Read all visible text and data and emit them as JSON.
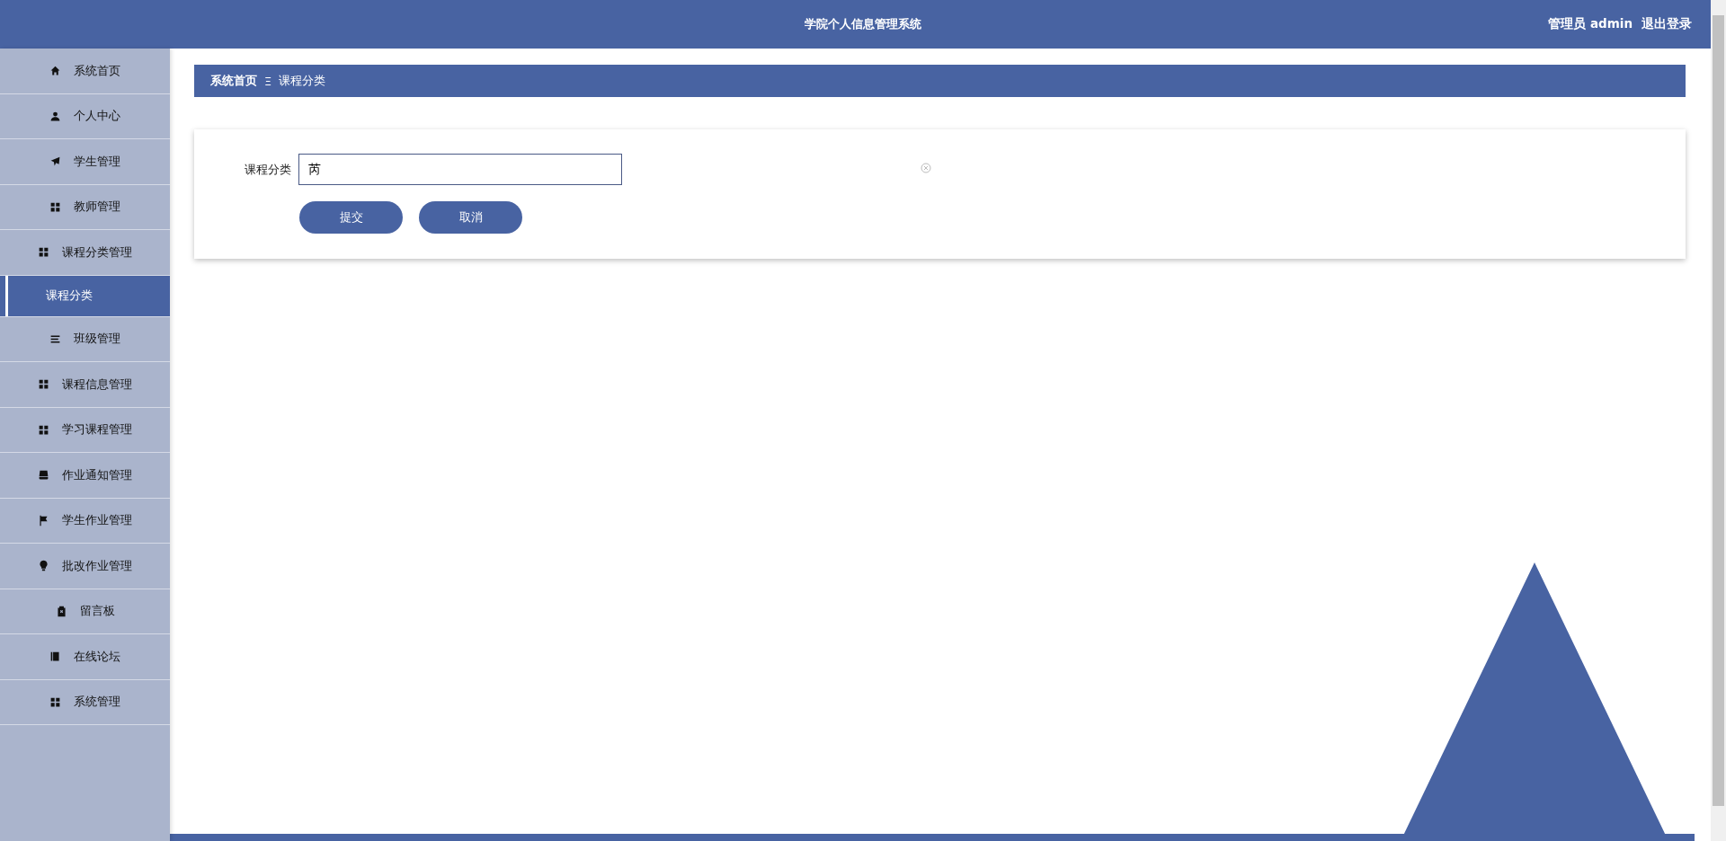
{
  "header": {
    "title": "学院个人信息管理系统",
    "user": "管理员 admin",
    "logout": "退出登录"
  },
  "sidebar": {
    "items": [
      {
        "label": "系统首页",
        "kind": "home",
        "selected": false
      },
      {
        "label": "个人中心",
        "kind": "user",
        "selected": false
      },
      {
        "label": "学生管理",
        "kind": "plane",
        "selected": false
      },
      {
        "label": "教师管理",
        "kind": "grid",
        "selected": false
      },
      {
        "label": "课程分类管理",
        "kind": "grid",
        "selected": false,
        "expanded": true,
        "children": [
          {
            "label": "课程分类",
            "selected": true
          }
        ]
      },
      {
        "label": "班级管理",
        "kind": "bars",
        "selected": false
      },
      {
        "label": "课程信息管理",
        "kind": "grid",
        "selected": false
      },
      {
        "label": "学习课程管理",
        "kind": "grid",
        "selected": false
      },
      {
        "label": "作业通知管理",
        "kind": "inbox",
        "selected": false
      },
      {
        "label": "学生作业管理",
        "kind": "flag",
        "selected": false
      },
      {
        "label": "批改作业管理",
        "kind": "bulb",
        "selected": false
      },
      {
        "label": "留言板",
        "kind": "clipboard",
        "selected": false
      },
      {
        "label": "在线论坛",
        "kind": "book",
        "selected": false
      },
      {
        "label": "系统管理",
        "kind": "grid",
        "selected": false
      }
    ]
  },
  "breadcrumb": {
    "home": "系统首页",
    "separator": "Ξ",
    "current": "课程分类"
  },
  "form": {
    "fields": [
      {
        "label": "课程分类",
        "value": "芮"
      }
    ],
    "buttons": [
      "提交",
      "取消"
    ]
  }
}
